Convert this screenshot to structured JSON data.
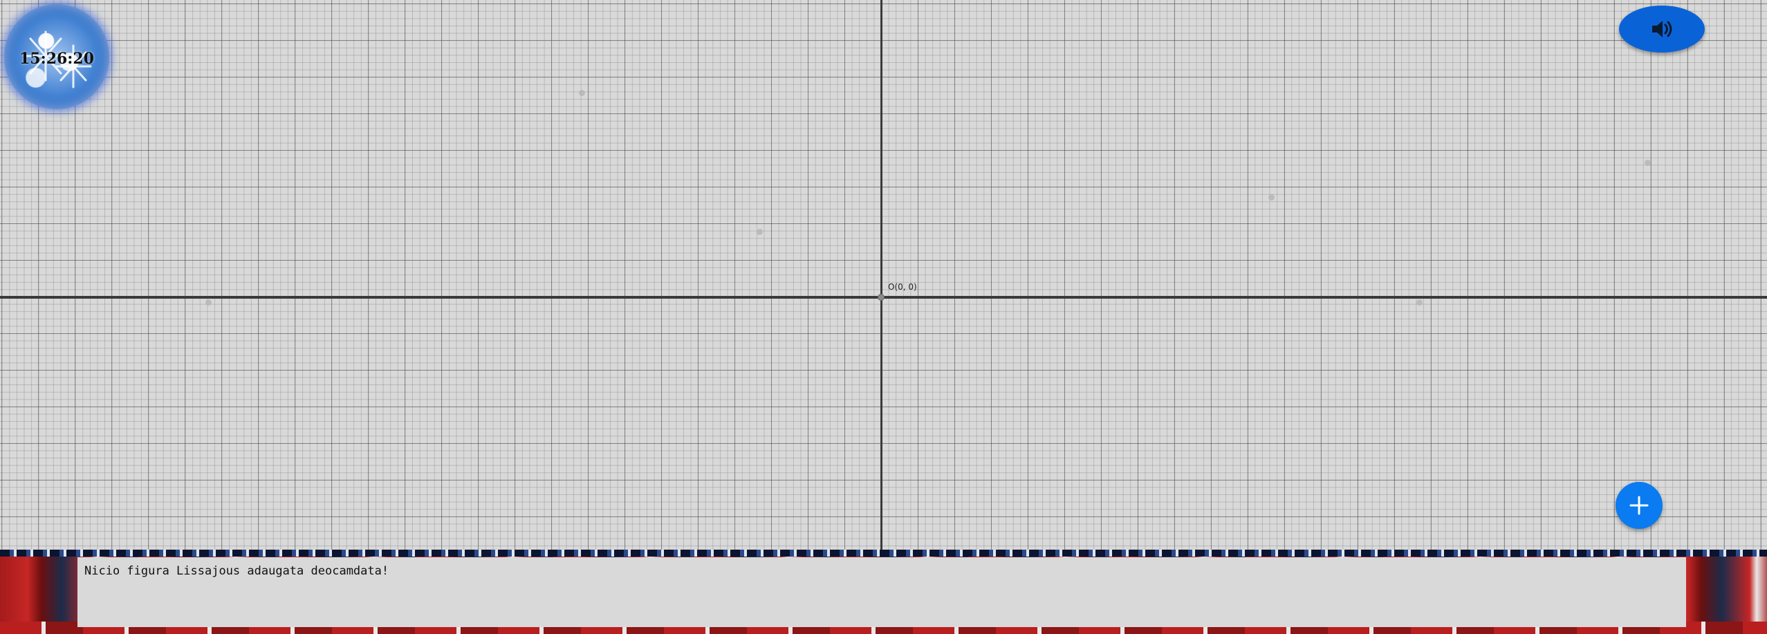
{
  "clock": {
    "time": "15:26:20"
  },
  "graph": {
    "origin_label": "O(0, 0)"
  },
  "controls": {
    "sound_icon": "volume-icon",
    "add_icon": "plus-icon"
  },
  "message": {
    "text": "Nicio figura Lissajous adaugata deocamdata!"
  },
  "colors": {
    "primary_button": "#0a63d6",
    "add_button": "#0a7bf0",
    "canvas": "#d9d9d9",
    "axis": "#3a3a3a"
  }
}
